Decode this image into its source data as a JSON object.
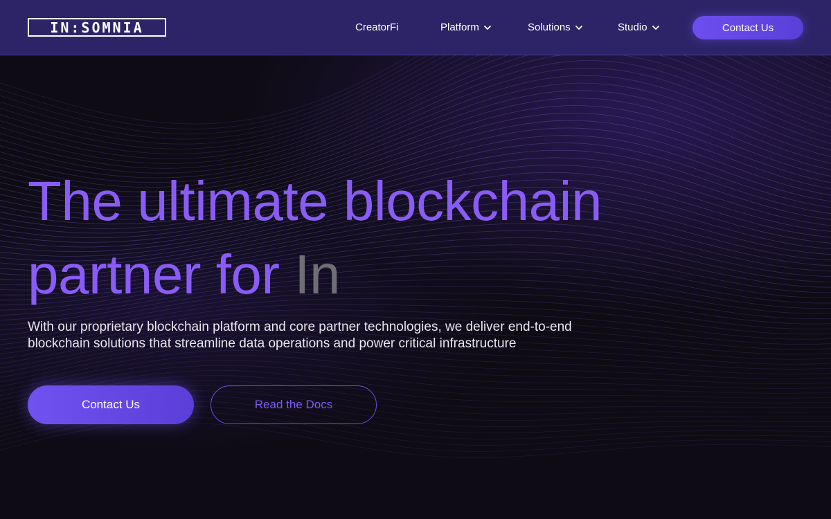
{
  "logo": {
    "text": "IN:SOMNIA"
  },
  "nav": {
    "items": [
      {
        "label": "CreatorFi",
        "dropdown": false
      },
      {
        "label": "Platform",
        "dropdown": true
      },
      {
        "label": "Solutions",
        "dropdown": true
      },
      {
        "label": "Studio",
        "dropdown": true
      }
    ],
    "cta_label": "Contact Us"
  },
  "hero": {
    "headline_line1": "The ultimate blockchain",
    "headline_line2": "partner for",
    "typed_word": "In",
    "subtext": "With our proprietary blockchain platform and core partner technologies, we deliver end-to-end blockchain solutions that streamline data operations and power critical infrastructure",
    "primary_button": "Contact Us",
    "secondary_button": "Read the Docs"
  },
  "colors": {
    "nav_bg": "#2d2468",
    "accent": "#8a5cf6",
    "button": "#6d4ef0",
    "page_bg": "#0e0b14",
    "typed_word": "#6e6e74"
  }
}
